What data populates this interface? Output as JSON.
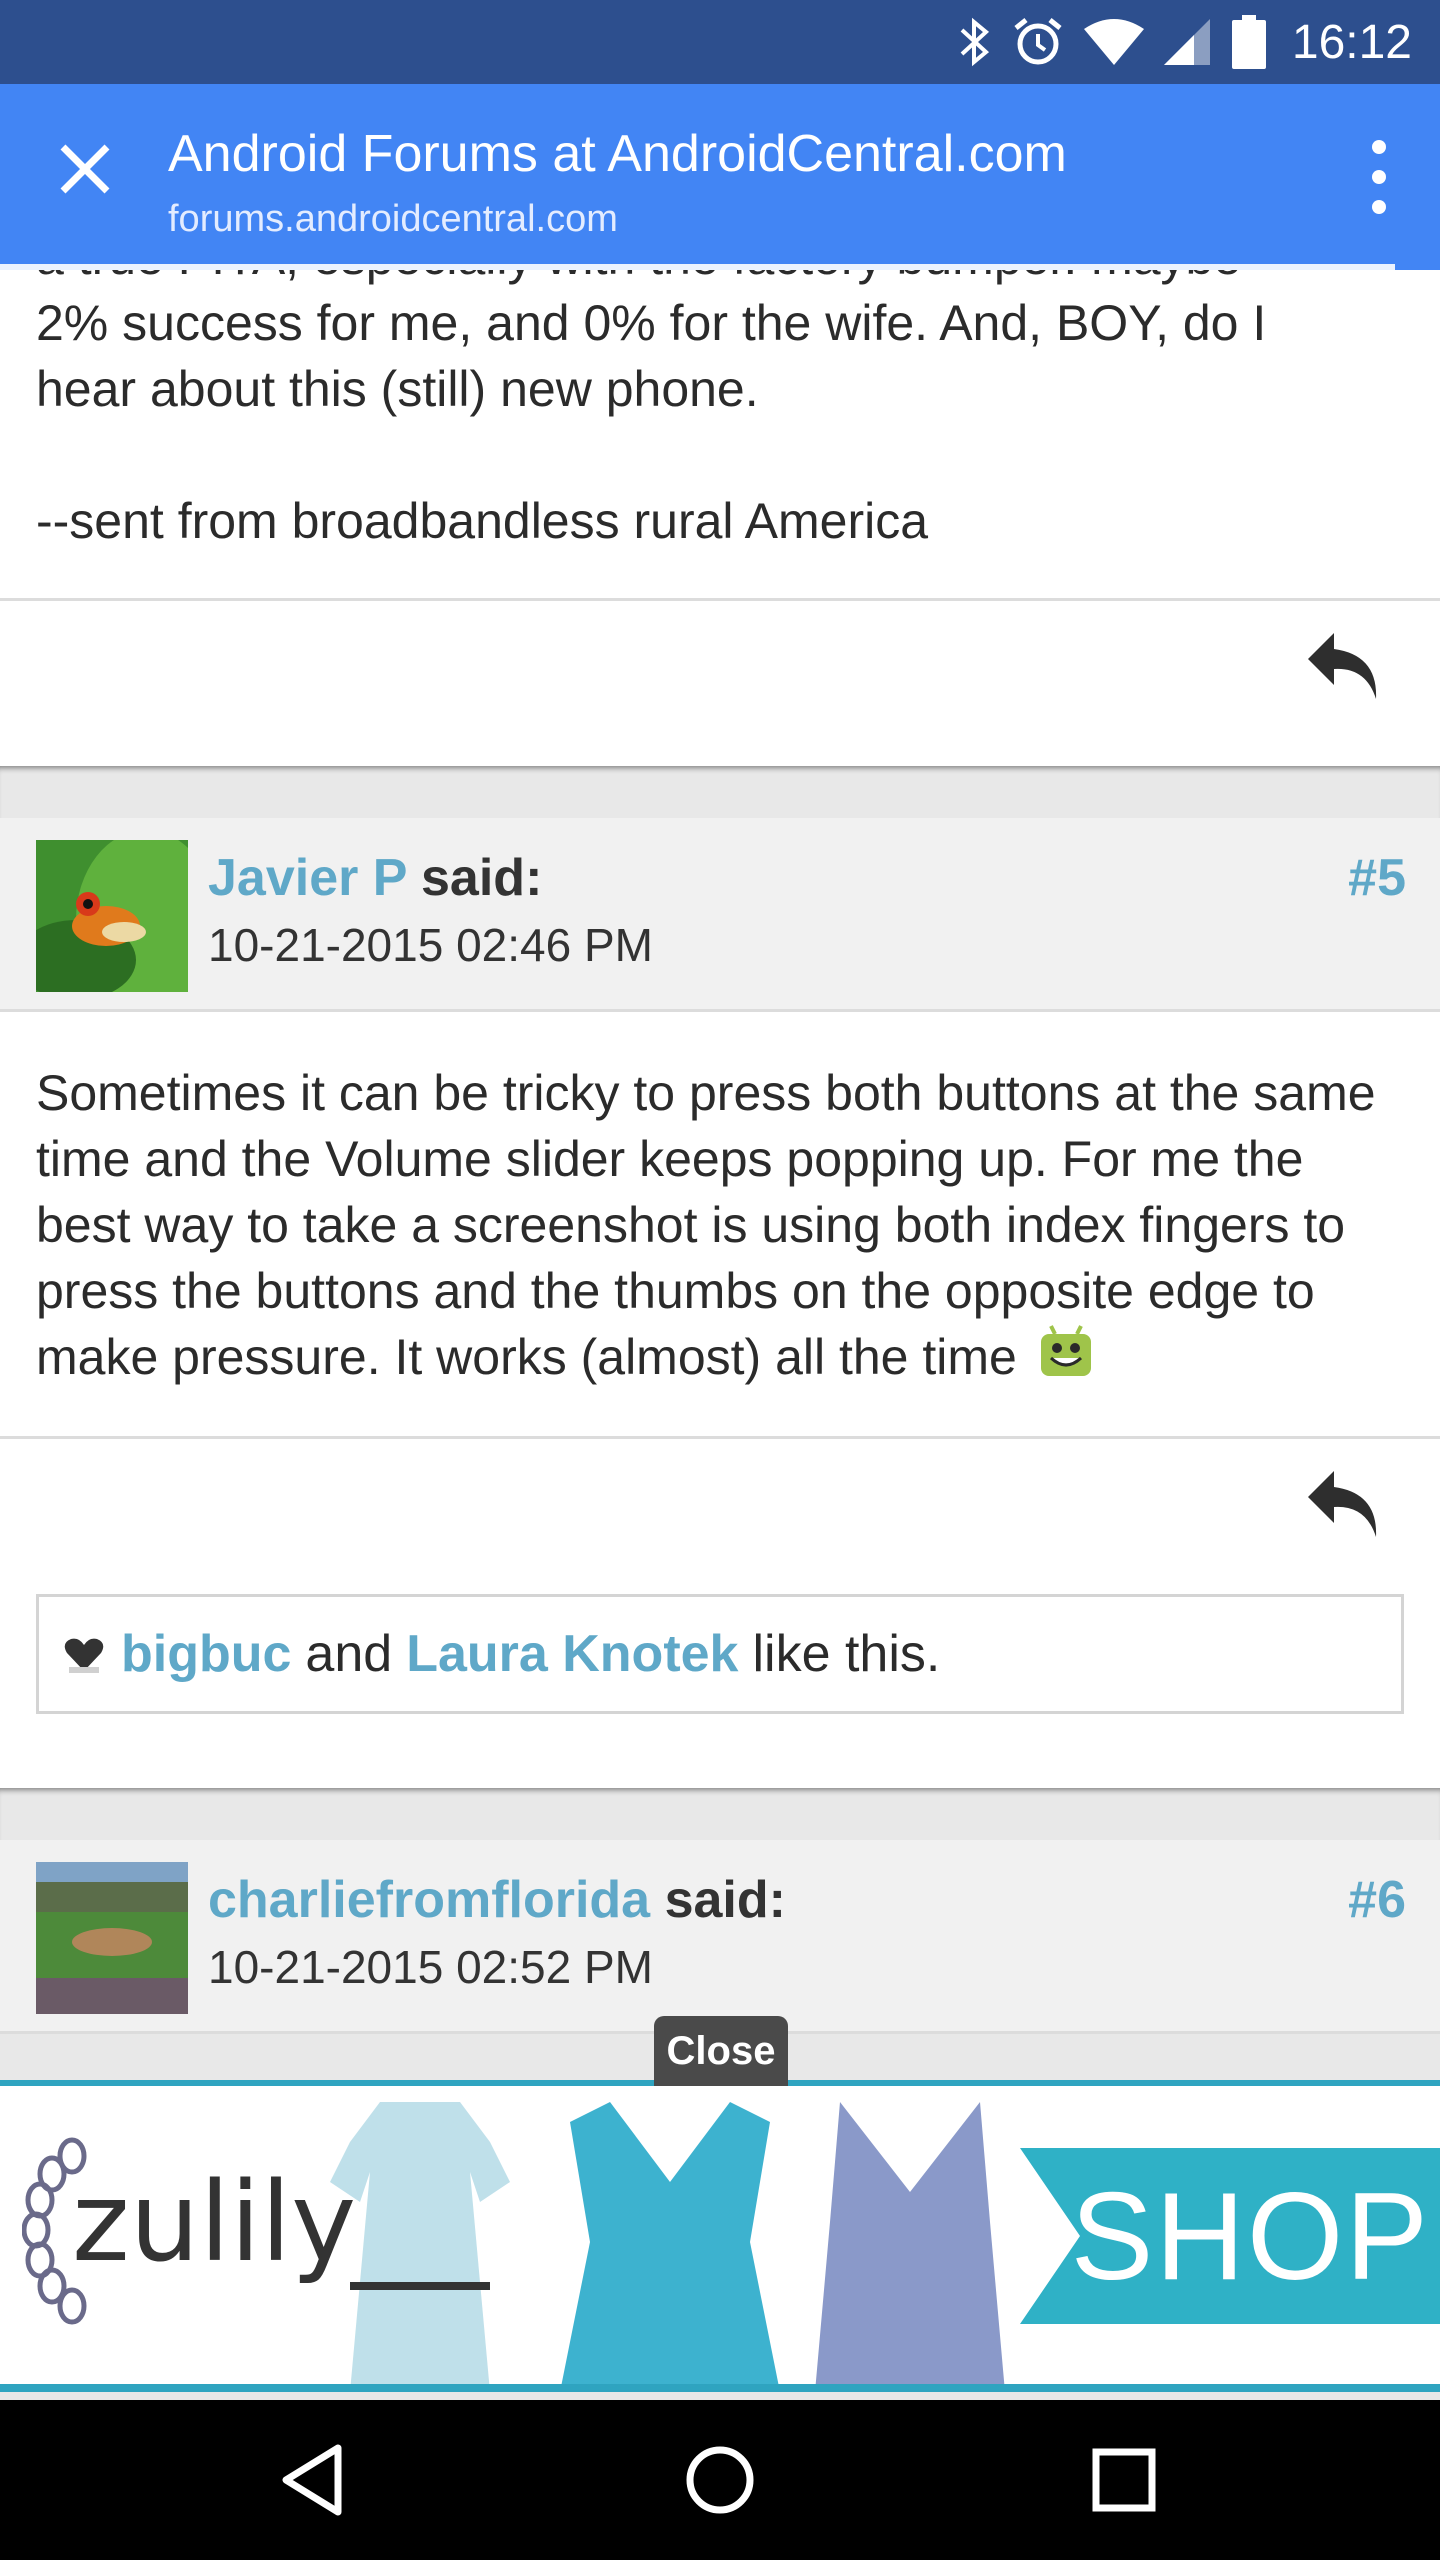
{
  "status_bar": {
    "time": "16:12",
    "icons": [
      "bluetooth-icon",
      "alarm-icon",
      "wifi-icon",
      "signal-icon",
      "battery-icon"
    ]
  },
  "toolbar": {
    "title": "Android Forums at AndroidCentral.com",
    "url": "forums.androidcentral.com",
    "close_icon": "close-icon",
    "menu_icon": "overflow-menu-icon"
  },
  "previous_post": {
    "partial_line": "a true PITA, especially with the factory bumper. maybe",
    "text_lines": [
      "2% success for me, and 0% for the wife. And, BOY, do I",
      "hear about this (still) new phone."
    ],
    "signature": "--sent from broadbandless rural America"
  },
  "post5": {
    "username": "Javier P",
    "said": "said:",
    "date": "10-21-2015 02:46 PM",
    "number": "#5",
    "body": "Sometimes it can be tricky to press both buttons at the same time and the Volume slider keeps popping up. For me the best way to take a screenshot is using both index fingers to press the buttons and the thumbs on the opposite edge to make pressure. It works (almost) all the time",
    "likes": {
      "user1": "bigbuc",
      "and": "and",
      "user2": "Laura Knotek",
      "suffix": "like this."
    }
  },
  "post6": {
    "username": "charliefromflorida",
    "said": "said:",
    "date": "10-21-2015 02:52 PM",
    "number": "#6"
  },
  "ad": {
    "close_label": "Close",
    "brand": "zulily",
    "cta": "SHOP",
    "colors": {
      "accent": "#2fb1c6"
    }
  },
  "colors": {
    "status_bar": "#2d4f8e",
    "toolbar": "#4285f4",
    "link": "#5fa8c8"
  }
}
